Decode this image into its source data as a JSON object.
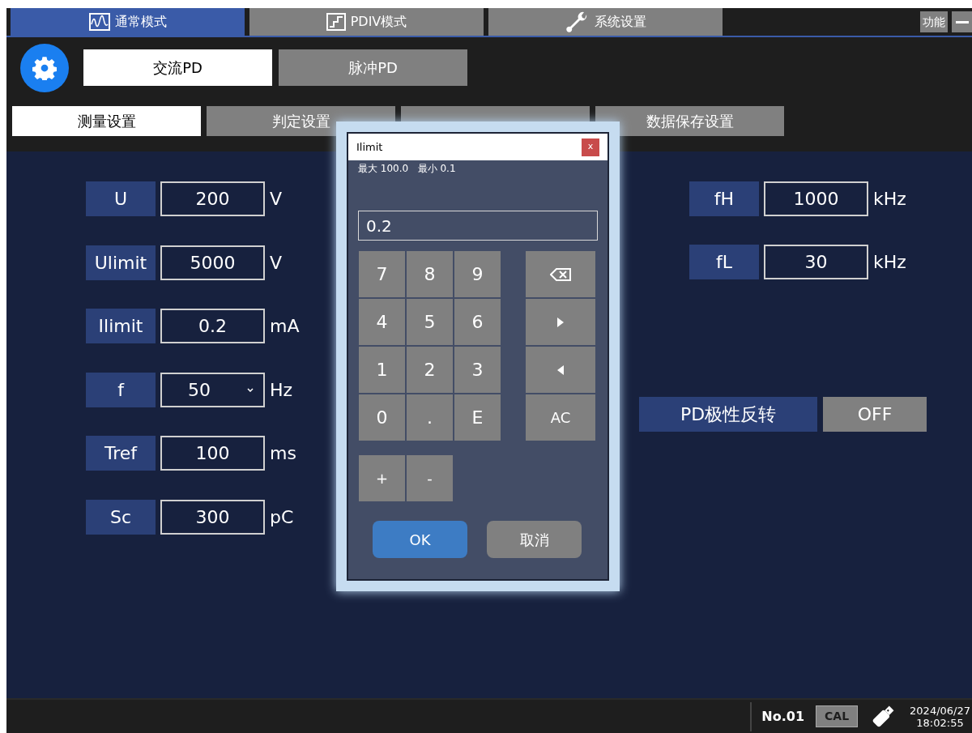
{
  "mode_tabs": [
    {
      "label": "通常模式",
      "kind": "wave",
      "selected": true
    },
    {
      "label": "PDIV模式",
      "kind": "step",
      "selected": false
    },
    {
      "label": "系统设置",
      "kind": "wrench",
      "selected": false
    }
  ],
  "function_button": "功能",
  "type_tabs": [
    {
      "label": "交流PD",
      "selected": true
    },
    {
      "label": "脉冲PD",
      "selected": false
    }
  ],
  "settings_tabs": [
    {
      "label": "测量设置",
      "selected": true
    },
    {
      "label": "判定设置",
      "selected": false
    },
    {
      "selected": false
    },
    {
      "label": "数据保存设置",
      "selected": false
    }
  ],
  "left_params": [
    {
      "label": "U",
      "value": "200",
      "unit": "V",
      "kind": "input"
    },
    {
      "label": "Ulimit",
      "value": "5000",
      "unit": "V",
      "kind": "input"
    },
    {
      "label": "Ilimit",
      "value": "0.2",
      "unit": "mA",
      "kind": "input"
    },
    {
      "label": "f",
      "value": "50",
      "unit": "Hz",
      "kind": "dropdown"
    },
    {
      "label": "Tref",
      "value": "100",
      "unit": "ms",
      "kind": "input"
    },
    {
      "label": "Sc",
      "value": "300",
      "unit": "pC",
      "kind": "input"
    }
  ],
  "right_params": [
    {
      "label": "fH",
      "value": "1000",
      "unit": "kHz",
      "kind": "input"
    },
    {
      "label": "fL",
      "value": "30",
      "unit": "kHz",
      "kind": "input"
    }
  ],
  "polarity": {
    "label": "PD极性反转",
    "value": "OFF"
  },
  "dialog": {
    "title": "Ilimit",
    "close": "x",
    "range": "最大 100.0   最小 0.1",
    "value": "0.2",
    "digits": [
      "7",
      "8",
      "9",
      "4",
      "5",
      "6",
      "1",
      "2",
      "3",
      "0",
      ".",
      "E"
    ],
    "side_keys": [
      {
        "kind": "backspace"
      },
      {
        "kind": "right"
      },
      {
        "kind": "left"
      },
      {
        "kind": "text",
        "label": "AC"
      }
    ],
    "sign_keys": [
      "+",
      "-"
    ],
    "ok": "OK",
    "cancel": "取消"
  },
  "status_bar": {
    "number": "No.01",
    "cal": "CAL",
    "date": "2024/06/27",
    "time": "18:02:55"
  }
}
